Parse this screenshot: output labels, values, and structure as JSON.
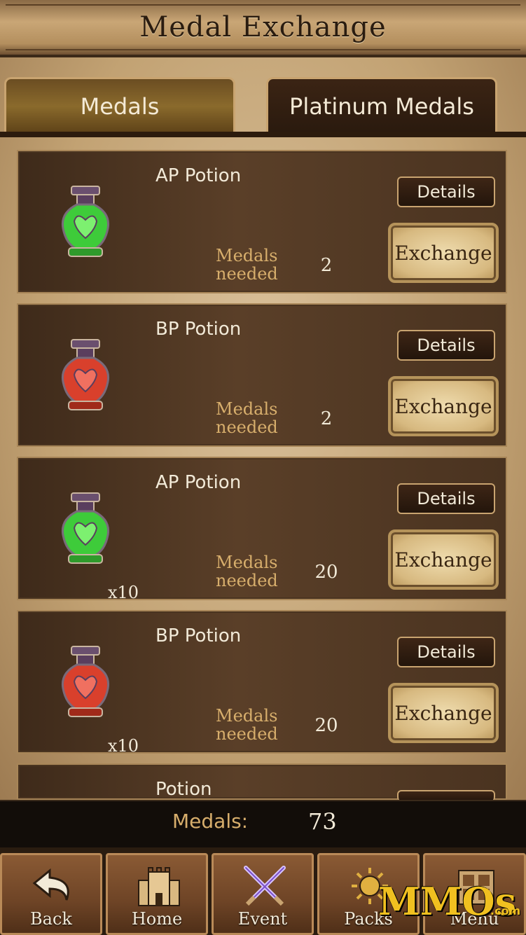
{
  "header": {
    "title": "Medal Exchange"
  },
  "tabs": [
    {
      "label": "Medals",
      "active": true
    },
    {
      "label": "Platinum Medals",
      "active": false
    }
  ],
  "items": [
    {
      "name": "AP Potion",
      "icon": "green-potion-icon",
      "quantity": "",
      "needed_label": "Medals needed",
      "cost": "2",
      "details_label": "Details",
      "exchange_label": "Exchange"
    },
    {
      "name": "BP Potion",
      "icon": "red-potion-icon",
      "quantity": "",
      "needed_label": "Medals needed",
      "cost": "2",
      "details_label": "Details",
      "exchange_label": "Exchange"
    },
    {
      "name": "AP Potion",
      "icon": "green-potion-icon",
      "quantity": "x10",
      "needed_label": "Medals needed",
      "cost": "20",
      "details_label": "Details",
      "exchange_label": "Exchange"
    },
    {
      "name": "BP Potion",
      "icon": "red-potion-icon",
      "quantity": "x10",
      "needed_label": "Medals needed",
      "cost": "20",
      "details_label": "Details",
      "exchange_label": "Exchange"
    },
    {
      "name": "Potion",
      "icon": "potion-icon",
      "quantity": "",
      "needed_label": "",
      "cost": "",
      "details_label": "",
      "exchange_label": ""
    }
  ],
  "balance": {
    "label": "Medals:",
    "value": "73"
  },
  "nav": [
    {
      "label": "Back",
      "icon": "back-arrow-icon"
    },
    {
      "label": "Home",
      "icon": "castle-icon"
    },
    {
      "label": "Event",
      "icon": "crossed-swords-icon"
    },
    {
      "label": "Packs",
      "icon": "sun-emblem-icon"
    },
    {
      "label": "Menu",
      "icon": "menu-grid-icon"
    }
  ],
  "watermark": {
    "text": "MMOs",
    "suffix": ".com"
  },
  "colors": {
    "green_potion": "#3ecb3a",
    "red_potion": "#d9402c",
    "gold_text": "#d7ae6c"
  }
}
